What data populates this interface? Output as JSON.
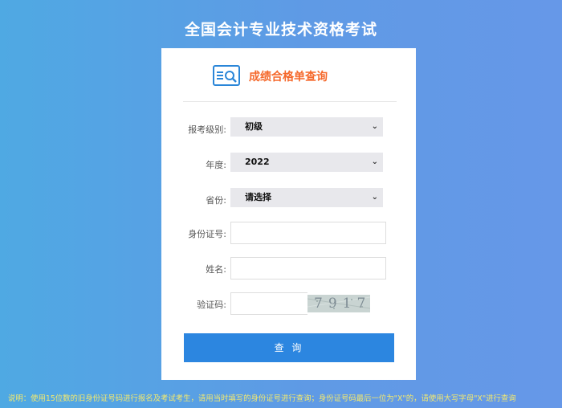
{
  "page": {
    "title": "全国会计专业技术资格考试"
  },
  "card": {
    "heading": "成绩合格单查询",
    "fields": {
      "level": {
        "label": "报考级别:",
        "value": "初级"
      },
      "year": {
        "label": "年度:",
        "value": "2022"
      },
      "province": {
        "label": "省份:",
        "value": "请选择"
      },
      "id_number": {
        "label": "身份证号:",
        "value": ""
      },
      "name": {
        "label": "姓名:",
        "value": ""
      },
      "captcha": {
        "label": "验证码:",
        "value": "",
        "code": "7917"
      }
    },
    "submit_label": "查 询"
  },
  "footnote": "说明：使用15位数的旧身份证号码进行报名及考试考生，请用当时填写的身份证号进行查询；身份证号码最后一位为\"X\"的，请使用大写字母\"X\"进行查询",
  "colors": {
    "accent": "#2c86e0",
    "heading": "#f5692c",
    "footnote": "#f4e96d"
  },
  "icons": {
    "header": "search-document-icon",
    "select_arrow": "chevron-down-icon"
  }
}
